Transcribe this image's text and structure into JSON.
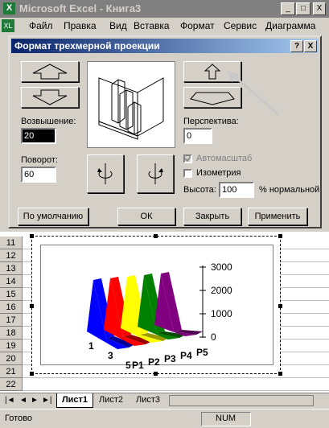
{
  "window": {
    "title": "Microsoft Excel - Книга3",
    "minimize": "_",
    "maximize": "□",
    "close": "X"
  },
  "menu": [
    "Файл",
    "Правка",
    "Вид",
    "Вставка",
    "Формат",
    "Сервис",
    "Диаграмма"
  ],
  "dialog": {
    "title": "Формат трехмерной проекции",
    "help": "?",
    "close": "X",
    "elevation_label": "Возвышение:",
    "elevation_value": "20",
    "rotation_label": "Поворот:",
    "rotation_value": "60",
    "perspective_label": "Перспектива:",
    "perspective_value": "0",
    "autoscale_label": "Автомасштаб",
    "isometric_label": "Изометрия",
    "height_label": "Высота:",
    "height_value": "100",
    "height_suffix": "% нормальной",
    "buttons": {
      "default": "По умолчанию",
      "ok": "ОК",
      "close": "Закрыть",
      "apply": "Применить"
    }
  },
  "rows": [
    "11",
    "12",
    "13",
    "14",
    "15",
    "16",
    "17",
    "18",
    "19",
    "20",
    "21",
    "22"
  ],
  "chart_data": {
    "type": "bar",
    "series": [
      {
        "name": "P1"
      },
      {
        "name": "P2"
      },
      {
        "name": "P3"
      },
      {
        "name": "P4"
      },
      {
        "name": "P5"
      }
    ],
    "categories": [
      "1",
      "3",
      "5"
    ],
    "y_ticks": [
      "3000",
      "2000",
      "1000",
      "0"
    ],
    "colors": [
      "#0000ff",
      "#ff0000",
      "#ffff00",
      "#008000",
      "#800080"
    ]
  },
  "sheets": [
    "Лист1",
    "Лист2",
    "Лист3"
  ],
  "status": {
    "left": "Готово",
    "num": "NUM"
  }
}
